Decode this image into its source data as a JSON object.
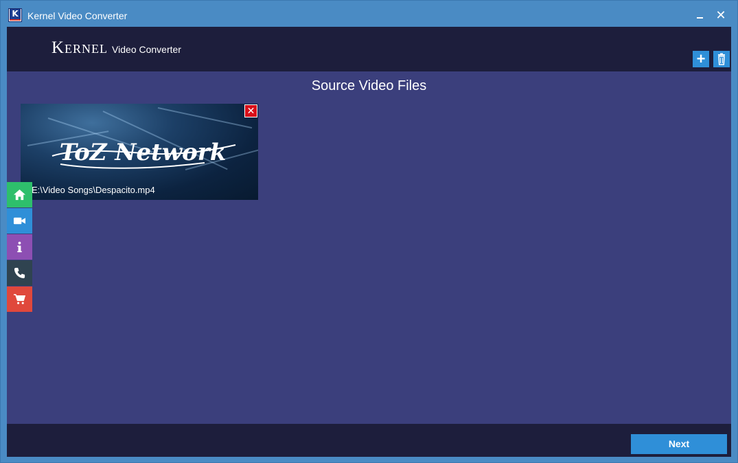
{
  "window": {
    "title": "Kernel Video Converter",
    "icon_letter": "K",
    "minimize_icon": "minimize-icon",
    "close_icon": "close-icon"
  },
  "header": {
    "brand_name": "Kernel",
    "brand_product": "Video Converter",
    "add_icon": "plus-icon",
    "delete_icon": "trash-icon"
  },
  "main": {
    "section_title": "Source Video Files",
    "files": [
      {
        "path": "E:\\Video Songs\\Despacito.mp4",
        "thumbnail_text": "ToZ Network",
        "remove_icon": "remove-x-icon"
      }
    ]
  },
  "sidebar": {
    "items": [
      {
        "icon": "home-icon",
        "color": "#2ebf6c"
      },
      {
        "icon": "video-camera-icon",
        "color": "#2f8fd8"
      },
      {
        "icon": "info-icon",
        "color": "#8d4fb3"
      },
      {
        "icon": "phone-icon",
        "color": "#2f4350"
      },
      {
        "icon": "cart-icon",
        "color": "#e0483c"
      }
    ]
  },
  "footer": {
    "next_label": "Next"
  },
  "colors": {
    "window_frame": "#4a8bc4",
    "header_bg": "#1d1e3c",
    "main_bg": "#3b3f7c",
    "accent": "#2f8fd8"
  }
}
